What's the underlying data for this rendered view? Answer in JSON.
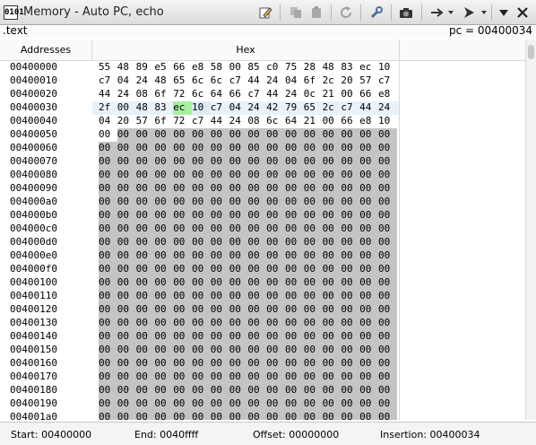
{
  "window": {
    "title": "Memory - Auto PC, echo",
    "icon_text": "0101"
  },
  "toolbar": {
    "icons": [
      "edit-icon",
      "copy-icon",
      "paste-icon",
      "refresh-icon",
      "wrench-icon",
      "camera-icon",
      "jump-arrow-icon",
      "step-cursor-icon",
      "dropdown-icon",
      "close-icon"
    ]
  },
  "info": {
    "section": ".text",
    "pc": "pc = 00400034"
  },
  "headers": {
    "addresses": "Addresses",
    "hex": "Hex"
  },
  "memory": {
    "addresses": [
      "00400000",
      "00400010",
      "00400020",
      "00400030",
      "00400040",
      "00400050",
      "00400060",
      "00400070",
      "00400080",
      "00400090",
      "004000a0",
      "004000b0",
      "004000c0",
      "004000d0",
      "004000e0",
      "004000f0",
      "00400100",
      "00400110",
      "00400120",
      "00400130",
      "00400140",
      "00400150",
      "00400160",
      "00400170",
      "00400180",
      "00400190",
      "004001a0"
    ],
    "rows": [
      [
        "55",
        "48",
        "89",
        "e5",
        "66",
        "e8",
        "58",
        "00",
        "85",
        "c0",
        "75",
        "28",
        "48",
        "83",
        "ec",
        "10"
      ],
      [
        "c7",
        "04",
        "24",
        "48",
        "65",
        "6c",
        "6c",
        "c7",
        "44",
        "24",
        "04",
        "6f",
        "2c",
        "20",
        "57",
        "c7"
      ],
      [
        "44",
        "24",
        "08",
        "6f",
        "72",
        "6c",
        "64",
        "66",
        "c7",
        "44",
        "24",
        "0c",
        "21",
        "00",
        "66",
        "e8"
      ],
      [
        "2f",
        "00",
        "48",
        "83",
        "ec",
        "10",
        "c7",
        "04",
        "24",
        "42",
        "79",
        "65",
        "2c",
        "c7",
        "44",
        "24"
      ],
      [
        "04",
        "20",
        "57",
        "6f",
        "72",
        "c7",
        "44",
        "24",
        "08",
        "6c",
        "64",
        "21",
        "00",
        "66",
        "e8",
        "10"
      ],
      [
        "00",
        "00",
        "00",
        "00",
        "00",
        "00",
        "00",
        "00",
        "00",
        "00",
        "00",
        "00",
        "00",
        "00",
        "00",
        "00"
      ],
      [
        "00",
        "00",
        "00",
        "00",
        "00",
        "00",
        "00",
        "00",
        "00",
        "00",
        "00",
        "00",
        "00",
        "00",
        "00",
        "00"
      ],
      [
        "00",
        "00",
        "00",
        "00",
        "00",
        "00",
        "00",
        "00",
        "00",
        "00",
        "00",
        "00",
        "00",
        "00",
        "00",
        "00"
      ],
      [
        "00",
        "00",
        "00",
        "00",
        "00",
        "00",
        "00",
        "00",
        "00",
        "00",
        "00",
        "00",
        "00",
        "00",
        "00",
        "00"
      ],
      [
        "00",
        "00",
        "00",
        "00",
        "00",
        "00",
        "00",
        "00",
        "00",
        "00",
        "00",
        "00",
        "00",
        "00",
        "00",
        "00"
      ],
      [
        "00",
        "00",
        "00",
        "00",
        "00",
        "00",
        "00",
        "00",
        "00",
        "00",
        "00",
        "00",
        "00",
        "00",
        "00",
        "00"
      ],
      [
        "00",
        "00",
        "00",
        "00",
        "00",
        "00",
        "00",
        "00",
        "00",
        "00",
        "00",
        "00",
        "00",
        "00",
        "00",
        "00"
      ],
      [
        "00",
        "00",
        "00",
        "00",
        "00",
        "00",
        "00",
        "00",
        "00",
        "00",
        "00",
        "00",
        "00",
        "00",
        "00",
        "00"
      ],
      [
        "00",
        "00",
        "00",
        "00",
        "00",
        "00",
        "00",
        "00",
        "00",
        "00",
        "00",
        "00",
        "00",
        "00",
        "00",
        "00"
      ],
      [
        "00",
        "00",
        "00",
        "00",
        "00",
        "00",
        "00",
        "00",
        "00",
        "00",
        "00",
        "00",
        "00",
        "00",
        "00",
        "00"
      ],
      [
        "00",
        "00",
        "00",
        "00",
        "00",
        "00",
        "00",
        "00",
        "00",
        "00",
        "00",
        "00",
        "00",
        "00",
        "00",
        "00"
      ],
      [
        "00",
        "00",
        "00",
        "00",
        "00",
        "00",
        "00",
        "00",
        "00",
        "00",
        "00",
        "00",
        "00",
        "00",
        "00",
        "00"
      ],
      [
        "00",
        "00",
        "00",
        "00",
        "00",
        "00",
        "00",
        "00",
        "00",
        "00",
        "00",
        "00",
        "00",
        "00",
        "00",
        "00"
      ],
      [
        "00",
        "00",
        "00",
        "00",
        "00",
        "00",
        "00",
        "00",
        "00",
        "00",
        "00",
        "00",
        "00",
        "00",
        "00",
        "00"
      ],
      [
        "00",
        "00",
        "00",
        "00",
        "00",
        "00",
        "00",
        "00",
        "00",
        "00",
        "00",
        "00",
        "00",
        "00",
        "00",
        "00"
      ],
      [
        "00",
        "00",
        "00",
        "00",
        "00",
        "00",
        "00",
        "00",
        "00",
        "00",
        "00",
        "00",
        "00",
        "00",
        "00",
        "00"
      ],
      [
        "00",
        "00",
        "00",
        "00",
        "00",
        "00",
        "00",
        "00",
        "00",
        "00",
        "00",
        "00",
        "00",
        "00",
        "00",
        "00"
      ],
      [
        "00",
        "00",
        "00",
        "00",
        "00",
        "00",
        "00",
        "00",
        "00",
        "00",
        "00",
        "00",
        "00",
        "00",
        "00",
        "00"
      ],
      [
        "00",
        "00",
        "00",
        "00",
        "00",
        "00",
        "00",
        "00",
        "00",
        "00",
        "00",
        "00",
        "00",
        "00",
        "00",
        "00"
      ],
      [
        "00",
        "00",
        "00",
        "00",
        "00",
        "00",
        "00",
        "00",
        "00",
        "00",
        "00",
        "00",
        "00",
        "00",
        "00",
        "00"
      ],
      [
        "00",
        "00",
        "00",
        "00",
        "00",
        "00",
        "00",
        "00",
        "00",
        "00",
        "00",
        "00",
        "00",
        "00",
        "00",
        "00"
      ],
      [
        "00",
        "00",
        "00",
        "00",
        "00",
        "00",
        "00",
        "00",
        "00",
        "00",
        "00",
        "00",
        "00",
        "00",
        "00",
        "00"
      ]
    ],
    "highlight_row": 3,
    "current_byte": [
      3,
      4
    ],
    "selected_byte": [
      3,
      5
    ],
    "gray_start": [
      5,
      1
    ]
  },
  "colors": {
    "current_byte": "#a6f0a0",
    "selected_byte": "#ddebf7",
    "gray_fill": "#c4c4c4",
    "row_highlight": "#e8f2fb"
  },
  "status": {
    "start": "Start:  00400000",
    "end": "End:  0040ffff",
    "offset": "Offset:  00000000",
    "insertion": "Insertion:  00400034"
  }
}
